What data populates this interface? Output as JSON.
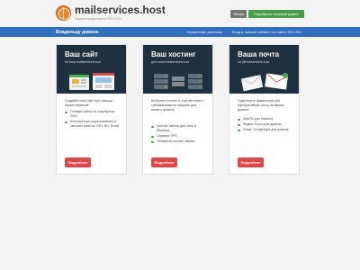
{
  "header": {
    "site_title": "mailservices.host",
    "site_subtitle": "Зарегистрирован в REG.RU",
    "whois_label": "Whois",
    "similar_domains_label": "Подобрать похожий домен"
  },
  "nav": {
    "owner_label": "Владельцу домена",
    "manage_domains_label": "Управление доменом",
    "cabinet_label": "Вход в личный кабинет на сайте REG.RU"
  },
  "cards": [
    {
      "title": "Ваш сайт",
      "subtitle": "на www.mailservices.host",
      "description": "Создайте свой сайт при помощи наших сервисов:",
      "items": [
        "Готовые сайты на популярных CMS",
        "Конструкторы корпоративных и светских визиток: REG.RU, Ecwid"
      ],
      "button_label": "Подробнее"
    },
    {
      "title": "Ваш хостинг",
      "subtitle": "для www.mailservices.host",
      "description": "Выберите хостинг в соот-ветствии с требованиями по нагрузке для вашего проекта:",
      "items": [
        "Хостинг сайтов для Linux и Windows",
        "Серверы VPS",
        "Облачный хостинг Jelastic"
      ],
      "button_label": "Подробнее"
    },
    {
      "title": "Ваша почта",
      "subtitle": "на @mailservices.host",
      "description": "Подключите фамильную или корпоративную почту на вашем домене:",
      "items": [
        "Mail.Ru для бизнеса",
        "Яндекс.Почта для домена",
        "Gmail, GoogleApps для домена"
      ],
      "button_label": "Подробнее"
    }
  ],
  "colors": {
    "navbar": "#2d6fbe",
    "card_header": "#1f3041",
    "button": "#e24545",
    "similar_button": "#43a047"
  }
}
